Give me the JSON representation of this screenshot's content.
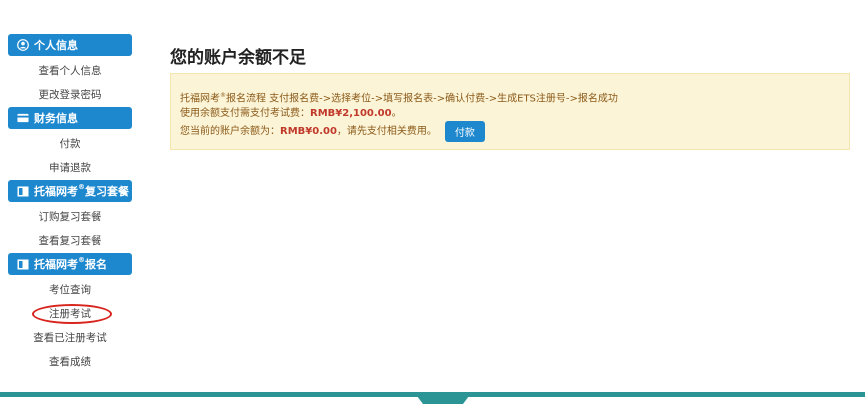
{
  "sidebar": {
    "sections": [
      {
        "title": "个人信息",
        "icon": "user-circle-icon",
        "items": [
          "查看个人信息",
          "更改登录密码"
        ]
      },
      {
        "title": "财务信息",
        "icon": "credit-card-icon",
        "items": [
          "付款",
          "申请退款"
        ]
      },
      {
        "title_main": "托福网考",
        "title_sup": "®",
        "title_tail": "复习套餐",
        "icon": "book-icon",
        "items": [
          "订购复习套餐",
          "查看复习套餐"
        ]
      },
      {
        "title_main": "托福网考",
        "title_sup": "®",
        "title_tail": "报名",
        "icon": "book-icon",
        "items": [
          "考位查询",
          "注册考试",
          "查看已注册考试",
          "查看成绩"
        ]
      }
    ],
    "highlighted_item": "注册考试"
  },
  "main": {
    "title": "您的账户余额不足",
    "notice": {
      "line1_a": "托福网考",
      "line1_sup": "®",
      "line1_b": "报名流程 支付报名费->选择考位->填写报名表->确认付费->生成ETS注册号->报名成功",
      "line2_text": "使用余额支付需支付考试费：",
      "line2_amount": "RMB¥2,100.00",
      "line2_end": "。",
      "line3_text": "您当前的账户余额为：",
      "line3_amount": "RMB¥0.00",
      "line3_end": "，请先支付相关费用。",
      "pay_button": "付款"
    }
  },
  "colors": {
    "primary": "#1e88cf",
    "notice_bg": "#fcf4d6",
    "notice_text": "#8a5a1a",
    "amount": "#c0392b",
    "highlight_circle": "#d8261f",
    "footer": "#2b9595"
  }
}
